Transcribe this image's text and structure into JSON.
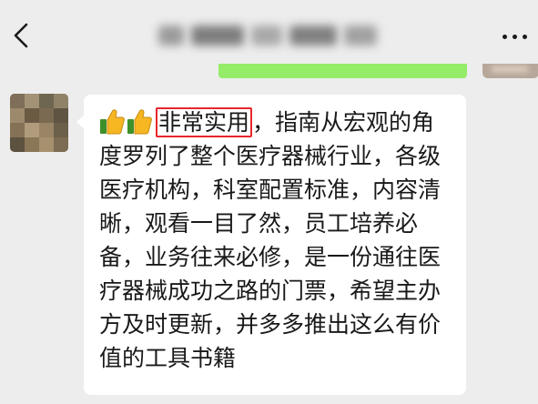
{
  "header": {
    "back_icon": "chevron-left-icon",
    "title": "",
    "title_obscured": true,
    "more_icon": "more-dots-icon"
  },
  "previous_message": {
    "bubble_color": "#95ec69"
  },
  "message": {
    "emoji": "thumbs-up",
    "emoji_count": 2,
    "highlighted_text": "非常实用",
    "highlight_color": "#e8262d",
    "text_after_highlight": "，指南从宏观的角度罗列了整个医疗器械行业，各级医疗机构，科室配置标准，内容清晰，观看一目了然，员工培养必备，业务往来必修，是一份通往医疗器械成功之路的门票，希望主办方及时更新，并多多推出这么有价值的工具书籍"
  },
  "colors": {
    "background": "#ededed",
    "bubble": "#ffffff",
    "text": "#191919"
  }
}
